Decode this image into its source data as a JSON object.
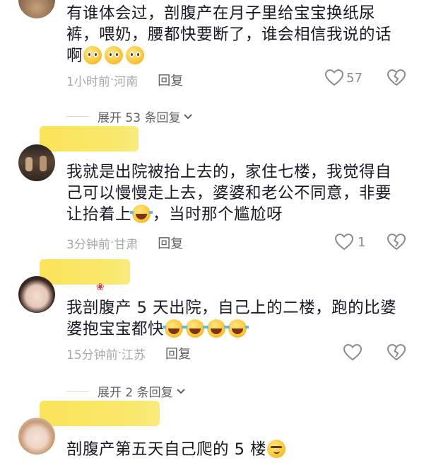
{
  "comments": [
    {
      "text_lines": [
        "有谁体会过，剖腹产在月子里给宝宝换纸尿",
        "裤，喂奶，腰都快要断了，谁会相信我说的话",
        "啊"
      ],
      "time": "1小时前",
      "location": "河南",
      "reply_label": "回复",
      "likes": "57"
    },
    {
      "text_lines": [
        "我就是出院被抬上去的，家住七楼，我觉得自",
        "己可以慢慢走上去，婆婆和老公不同意，非要",
        "让抬着上",
        "，当时那个尴尬呀"
      ],
      "time": "3分钟前",
      "location": "甘肃",
      "reply_label": "回复",
      "likes": "1"
    },
    {
      "text_lines": [
        "我剖腹产 5 天出院，自己上的二楼，跑的比婆",
        "婆抱宝宝都快"
      ],
      "time": "15分钟前",
      "location": "江苏",
      "reply_label": "回复",
      "likes": ""
    },
    {
      "text_lines": [
        "剖腹产第五天自己爬的 5 楼"
      ],
      "time": "",
      "location": "",
      "reply_label": "",
      "likes": ""
    }
  ],
  "expand_1": "展开 53 条回复",
  "expand_2": "展开 2 条回复",
  "separator": " · ",
  "colors": {
    "text": "#161823",
    "meta": "#a6a7ab",
    "reply": "#5f6066",
    "name_mask": "#f8e769"
  },
  "icons": [
    "heart-icon",
    "broken-heart-icon",
    "chevron-down-icon",
    "pleading-face-emoji",
    "rolling-laugh-emoji",
    "smirk-emoji"
  ]
}
